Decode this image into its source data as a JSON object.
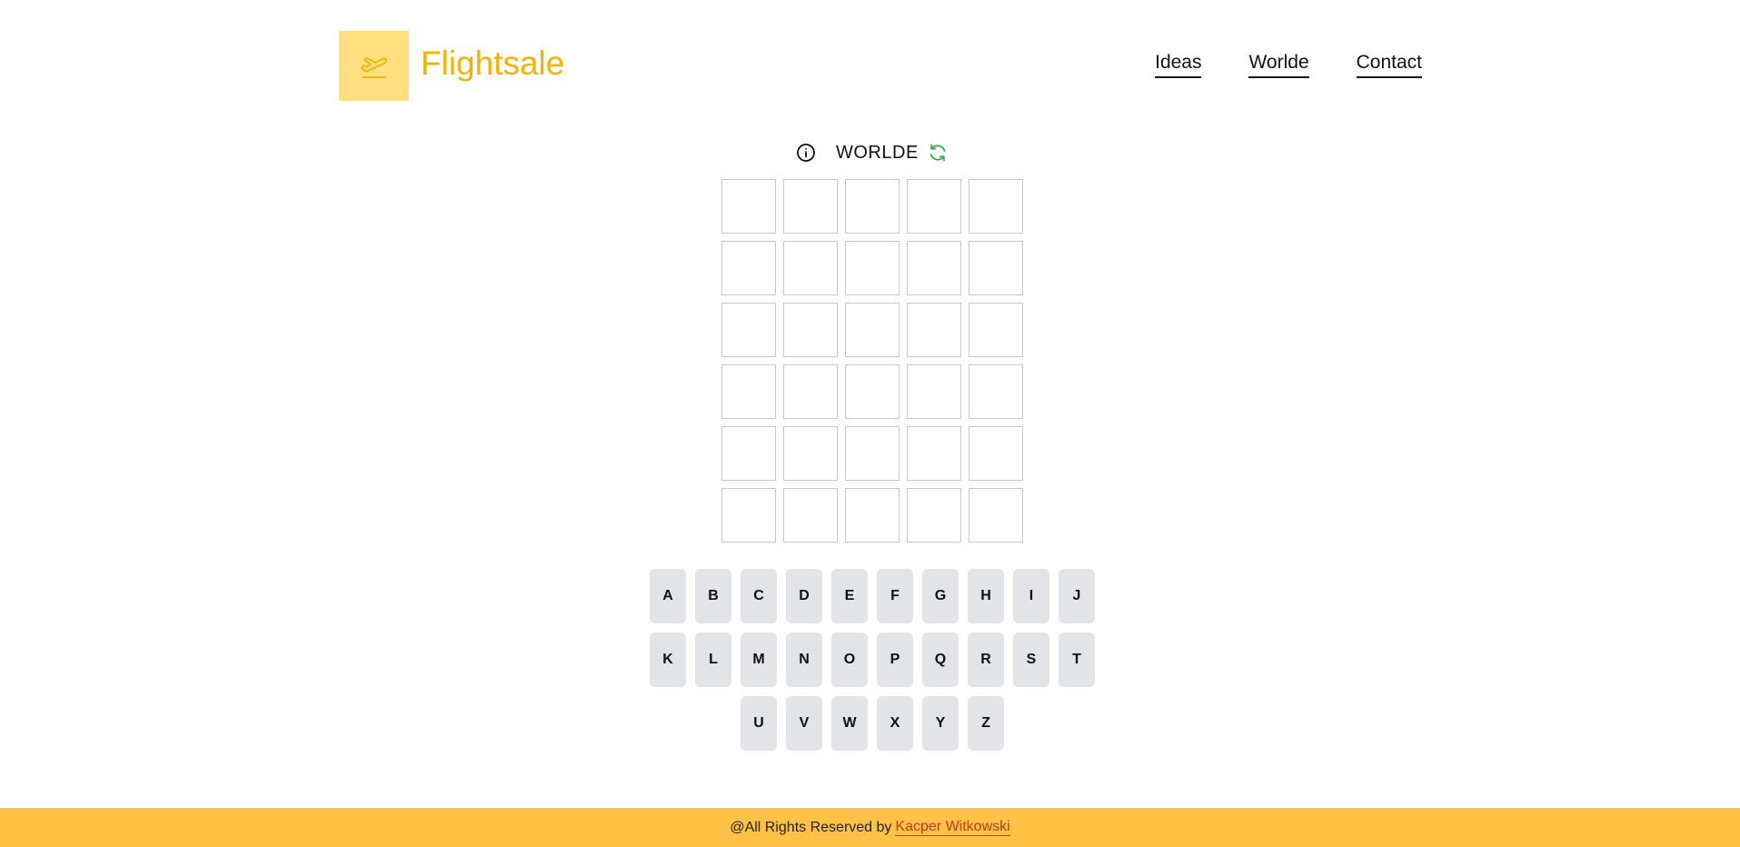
{
  "header": {
    "brand": "Flightsale",
    "logo_icon": "plane-departure-icon",
    "nav": [
      {
        "label": "Ideas"
      },
      {
        "label": "Worlde"
      },
      {
        "label": "Contact"
      }
    ]
  },
  "game": {
    "title": "WORLDE",
    "info_icon": "info-circle-icon",
    "refresh_icon": "refresh-icon",
    "rows": 6,
    "cols": 5,
    "guesses": [
      [
        "",
        "",
        "",
        "",
        ""
      ],
      [
        "",
        "",
        "",
        "",
        ""
      ],
      [
        "",
        "",
        "",
        "",
        ""
      ],
      [
        "",
        "",
        "",
        "",
        ""
      ],
      [
        "",
        "",
        "",
        "",
        ""
      ],
      [
        "",
        "",
        "",
        "",
        ""
      ]
    ]
  },
  "keyboard": {
    "rows": [
      [
        "A",
        "B",
        "C",
        "D",
        "E",
        "F",
        "G",
        "H",
        "I",
        "J"
      ],
      [
        "K",
        "L",
        "M",
        "N",
        "O",
        "P",
        "Q",
        "R",
        "S",
        "T"
      ],
      [
        "U",
        "V",
        "W",
        "X",
        "Y",
        "Z"
      ]
    ]
  },
  "footer": {
    "text": "@All Rights Reserved by",
    "author": "Kacper Witkowski"
  },
  "colors": {
    "accent": "#f4b400",
    "logo_bg": "#ffdf7f",
    "footer_bg": "#ffc245",
    "refresh": "#3aa655",
    "key_bg": "#e3e4e8"
  }
}
